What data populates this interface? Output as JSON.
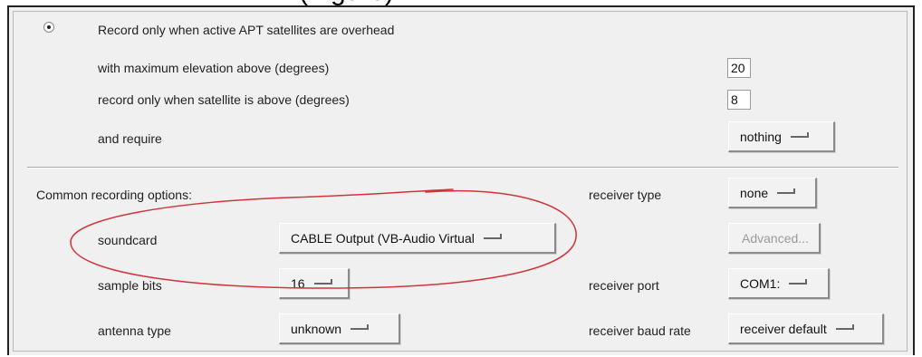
{
  "caption": "(Figure)",
  "apt_section": {
    "radio_label": "Record only when active APT satellites are overhead",
    "max_elevation_label": "with maximum elevation above (degrees)",
    "max_elevation_value": "20",
    "min_elevation_label": "record only when satellite is above (degrees)",
    "min_elevation_value": "8",
    "require_label": "and require",
    "require_value": "nothing"
  },
  "common": {
    "section_label": "Common recording options:",
    "receiver_type_label": "receiver type",
    "receiver_type_value": "none",
    "soundcard_label": "soundcard",
    "soundcard_value": "CABLE Output (VB-Audio Virtual",
    "advanced_label": "Advanced...",
    "sample_bits_label": "sample bits",
    "sample_bits_value": "16",
    "receiver_port_label": "receiver port",
    "receiver_port_value": "COM1:",
    "antenna_type_label": "antenna type",
    "antenna_type_value": "unknown",
    "baud_rate_label": "receiver baud rate",
    "baud_rate_value": "receiver default"
  },
  "colors": {
    "annotation": "#d0343a",
    "panel_bg": "#f0f0f0"
  }
}
